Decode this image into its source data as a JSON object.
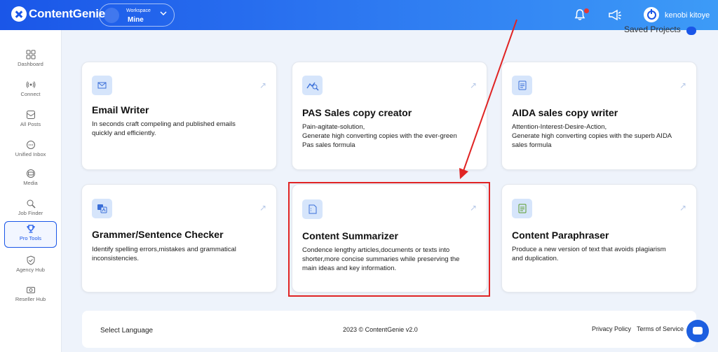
{
  "app": {
    "name": "ContentGenie"
  },
  "workspace": {
    "label": "Workspace",
    "value": "Mine"
  },
  "user": {
    "name": "kenobi kitoye"
  },
  "sidebar": {
    "items": [
      {
        "label": "Dashboard",
        "icon": "grid-icon"
      },
      {
        "label": "Connect",
        "icon": "broadcast-icon"
      },
      {
        "label": "All Posts",
        "icon": "inbox-icon"
      },
      {
        "label": "Unified Inbox",
        "icon": "chat-bubble-icon"
      },
      {
        "label": "Media",
        "icon": "media-icon"
      },
      {
        "label": "Job Finder",
        "icon": "search-icon"
      },
      {
        "label": "Pro Tools",
        "icon": "trophy-icon",
        "active": true
      },
      {
        "label": "Agency Hub",
        "icon": "badge-check-icon"
      },
      {
        "label": "Reseller Hub",
        "icon": "camera-icon"
      }
    ]
  },
  "saved_projects": {
    "label": "Saved Projects"
  },
  "cards": [
    {
      "title": "Email Writer",
      "icon": "mail-icon",
      "desc": [
        "In seconds craft compeling and published emails",
        "quickly and efficiently."
      ]
    },
    {
      "title": "PAS Sales copy creator",
      "icon": "chart-search-icon",
      "desc": [
        "Pain-agitate-solution,",
        "Generate high converting copies with the ever-green",
        "Pas sales formula"
      ]
    },
    {
      "title": "AIDA sales copy writer",
      "icon": "document-icon",
      "desc": [
        "Attention-Interest-Desire-Action,",
        "Generate high converting copies with the superb AIDA",
        "sales formula"
      ]
    },
    {
      "title": "Grammer/Sentence Checker",
      "icon": "translate-icon",
      "desc": [
        "Identify spelling errors,mistakes and grammatical",
        "inconsistencies."
      ]
    },
    {
      "title": "Content Summarizer",
      "icon": "file-icon",
      "desc": [
        "Condence lengthy articles,documents or texts into",
        "shorter,more concise summaries while preserving the",
        "main ideas and key information."
      ]
    },
    {
      "title": "Content Paraphraser",
      "icon": "paraphrase-doc-icon",
      "desc": [
        "Produce a new version of text that avoids plagiarism",
        "and duplication."
      ]
    }
  ],
  "footer": {
    "language": "Select Language",
    "copyright": "2023 © ContentGenie v2.0",
    "privacy": "Privacy Policy",
    "terms": "Terms of Service"
  },
  "colors": {
    "brand": "#1a56e8",
    "annotation": "#e02424"
  }
}
